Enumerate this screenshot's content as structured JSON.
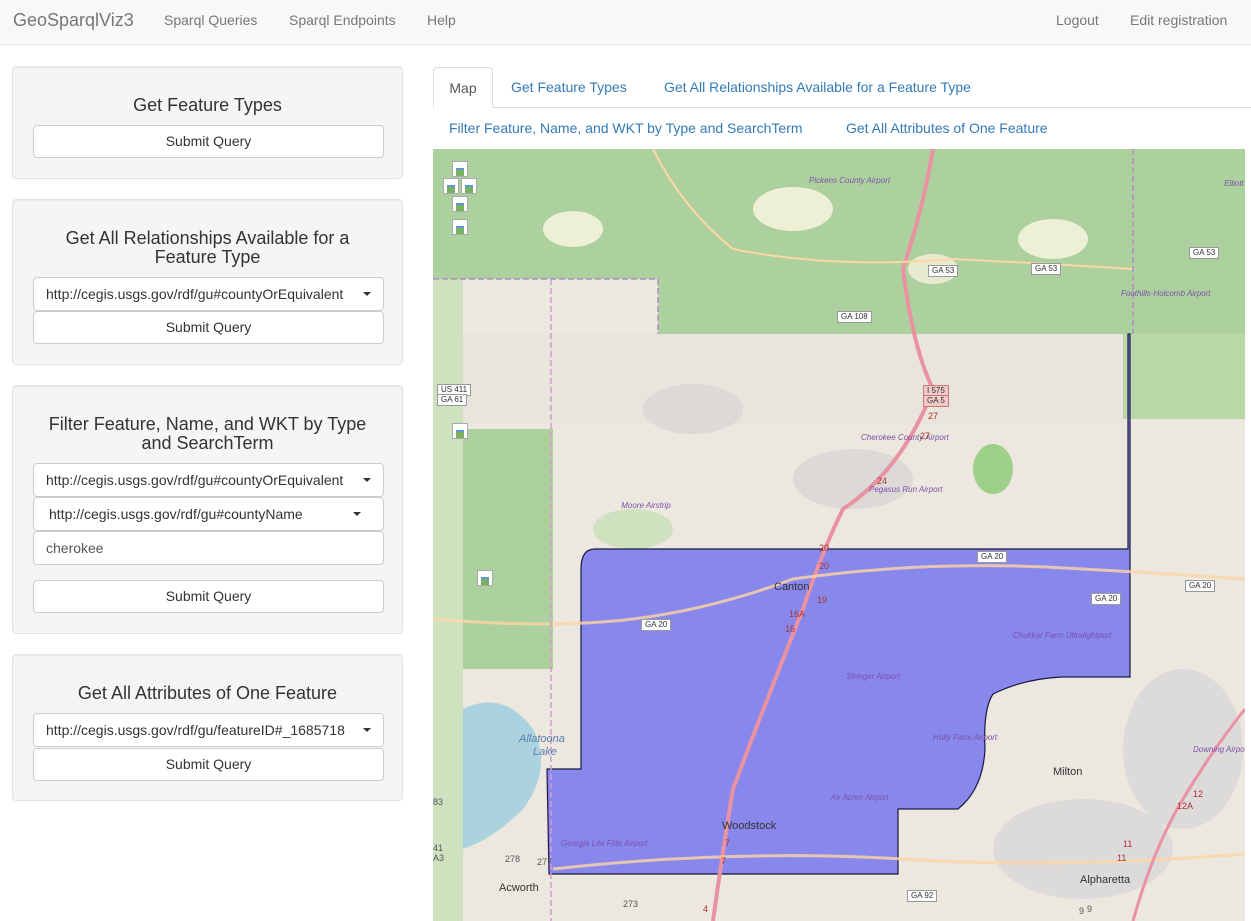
{
  "navbar": {
    "brand": "GeoSparqlViz3",
    "links": [
      "Sparql Queries",
      "Sparql Endpoints",
      "Help"
    ],
    "right_links": [
      "Logout",
      "Edit registration"
    ]
  },
  "panels": {
    "feature_types": {
      "title": "Get Feature Types",
      "submit": "Submit Query"
    },
    "relationships": {
      "title": "Get All Relationships Available for a Feature Type",
      "select": "http://cegis.usgs.gov/rdf/gu#countyOrEquivalent",
      "submit": "Submit Query"
    },
    "filter": {
      "title": "Filter Feature, Name, and WKT by Type and SearchTerm",
      "select_type": "http://cegis.usgs.gov/rdf/gu#countyOrEquivalent",
      "select_name": "http://cegis.usgs.gov/rdf/gu#countyName",
      "search_term": "cherokee",
      "submit": "Submit Query"
    },
    "attributes": {
      "title": "Get All Attributes of One Feature",
      "select": "http://cegis.usgs.gov/rdf/gu/featureID#_1685718",
      "submit": "Submit Query"
    }
  },
  "tabs": [
    "Map",
    "Get Feature Types",
    "Get All Relationships Available for a Feature Type",
    "Filter Feature, Name, and WKT by Type and SearchTerm",
    "Get All Attributes of One Feature"
  ],
  "map": {
    "cities": [
      "Canton",
      "Woodstock",
      "Acworth",
      "Alpharetta",
      "Milton"
    ],
    "water": [
      "Allatoona",
      "Lake"
    ],
    "airports": [
      "Pickens County Airport",
      "Foothills-Holcomb Airport",
      "Cherokee County Airport",
      "Pegasus Run Airport",
      "Moore Airstrip",
      "Chukkar Farm Ultralightport",
      "Stringer Airport",
      "Holly Farm Airport",
      "Air Acres Airport",
      "Georgia Lite Flite Airport",
      "Downing Airport",
      "Elliott"
    ],
    "shields": [
      "GA 53",
      "GA 53",
      "GA 53",
      "GA 108",
      "I 575",
      "GA 5",
      "US 411",
      "GA 61",
      "GA 20",
      "GA 20",
      "GA 20",
      "GA 20",
      "GA 92"
    ],
    "exits": [
      "27",
      "27",
      "24",
      "20",
      "20",
      "19",
      "16A",
      "16",
      "7",
      "7",
      "4",
      "278",
      "277",
      "273",
      "11",
      "11",
      "12",
      "12A",
      "83",
      "41",
      "A3",
      "9",
      "9"
    ],
    "colors": {
      "forest": "#add19e",
      "residential": "#e0dfdf",
      "county_fill": "#6b6cf0",
      "county_stroke": "#1a1a40",
      "motorway": "#e892a2",
      "primary": "#fcd6a4"
    }
  }
}
